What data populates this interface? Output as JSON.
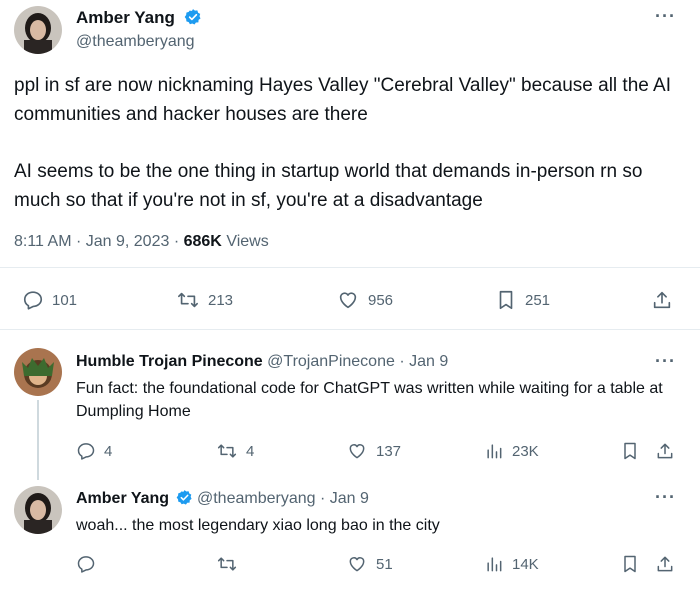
{
  "main_tweet": {
    "name": "Amber Yang",
    "handle": "@theamberyang",
    "paragraph1": "ppl in sf are now nicknaming Hayes Valley \"Cerebral Valley\" because all the AI communities and hacker houses are there",
    "paragraph2": "AI seems to be the one thing in startup world that demands in-person rn so much so that if you're not in sf, you're at a disadvantage",
    "time": "8:11 AM",
    "date": "Jan 9, 2023",
    "views_count": "686K",
    "views_label": "Views",
    "replies": "101",
    "retweets": "213",
    "likes": "956",
    "bookmarks": "251",
    "more": "···"
  },
  "reply1": {
    "name": "Humble Trojan Pinecone",
    "handle": "@TrojanPinecone",
    "date": "· Jan 9",
    "text": "Fun fact: the foundational code for ChatGPT was written while waiting for a table at Dumpling Home",
    "replies": "4",
    "retweets": "4",
    "likes": "137",
    "views": "23K",
    "more": "···"
  },
  "reply2": {
    "name": "Amber Yang",
    "handle": "@theamberyang",
    "date": "· Jan 9",
    "text": "woah... the most legendary xiao long bao in the city",
    "replies": "",
    "retweets": "",
    "likes": "51",
    "views": "14K",
    "more": "···"
  },
  "colors": {
    "verified": "#1d9bf0",
    "secondary_text": "#536471",
    "divider": "#e6ecf0"
  },
  "icons": [
    "verified-badge-icon",
    "reply-icon",
    "retweet-icon",
    "like-icon",
    "bookmark-icon",
    "share-icon",
    "views-icon",
    "more-icon"
  ]
}
